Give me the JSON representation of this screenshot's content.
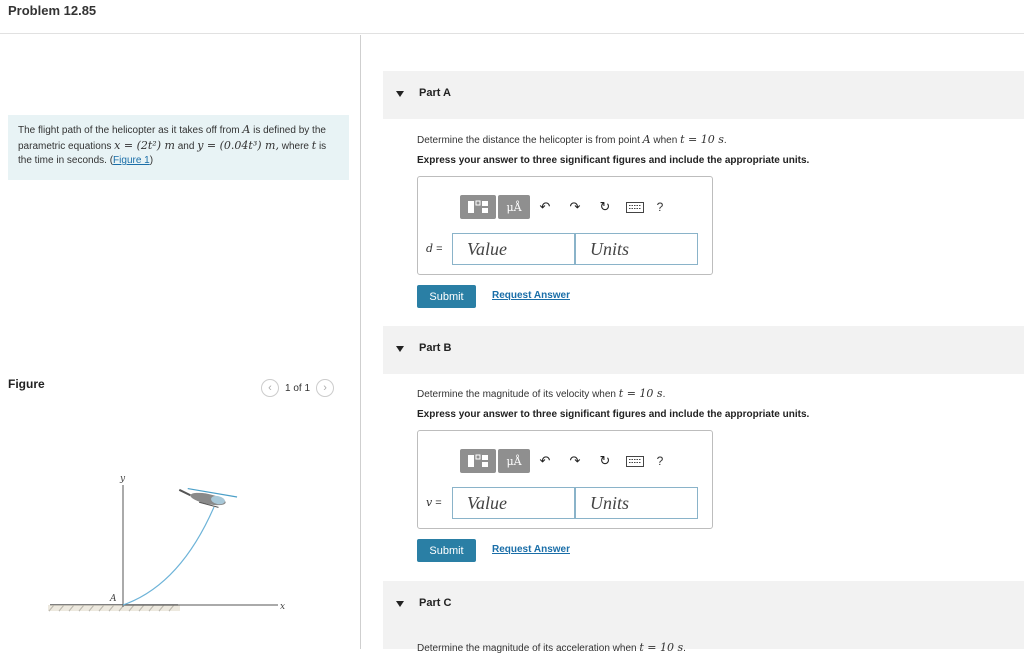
{
  "header": {
    "title": "Problem 12.85"
  },
  "problem": {
    "text_1": "The flight path of the helicopter as it takes off from ",
    "point": "A",
    "text_2": " is defined by the parametric equations ",
    "x_eq": "x = (2t²) m",
    "text_3": " and ",
    "y_eq": "y = (0.04t³) m,",
    "text_4": " where ",
    "t_var": "t",
    "text_5": " is the time in seconds. (",
    "figure_link": "Figure 1",
    "text_6": ")"
  },
  "figure": {
    "label": "Figure",
    "pager": "1 of 1",
    "prev_icon": "chevron-left-icon",
    "next_icon": "chevron-right-icon",
    "axis_y": "y",
    "axis_x": "x",
    "point_A": "A"
  },
  "parts": [
    {
      "label": "Part A",
      "prompt_1": "Determine the distance the helicopter is from point ",
      "prompt_point": "A",
      "prompt_2": " when ",
      "prompt_eq": "t = 10 s",
      "prompt_3": ".",
      "instruction": "Express your answer to three significant figures and include the appropriate units.",
      "variable": "d",
      "equals": " =",
      "value_placeholder": "Value",
      "units_placeholder": "Units",
      "submit_label": "Submit",
      "request_label": "Request Answer"
    },
    {
      "label": "Part B",
      "prompt_1": "Determine the magnitude of its velocity when ",
      "prompt_eq": "t = 10 s",
      "prompt_3": ".",
      "instruction": "Express your answer to three significant figures and include the appropriate units.",
      "variable": "v",
      "equals": " =",
      "value_placeholder": "Value",
      "units_placeholder": "Units",
      "submit_label": "Submit",
      "request_label": "Request Answer"
    },
    {
      "label": "Part C",
      "prompt_1": "Determine the magnitude of its acceleration when ",
      "prompt_eq": "t = 10 s",
      "prompt_3": "."
    }
  ],
  "toolbar": {
    "templates_icon": "templates-icon",
    "units_symbol": "μÅ",
    "undo_icon": "undo-icon",
    "redo_icon": "redo-icon",
    "reset_icon": "reset-icon",
    "keyboard_icon": "keyboard-icon",
    "help_label": "?"
  },
  "colors": {
    "accent": "#2a7fa5",
    "link": "#1a6ea8",
    "problem_bg": "#e8f3f5",
    "part_header_bg": "#f2f2f2",
    "toolbar_btn": "#8f8f8f"
  }
}
